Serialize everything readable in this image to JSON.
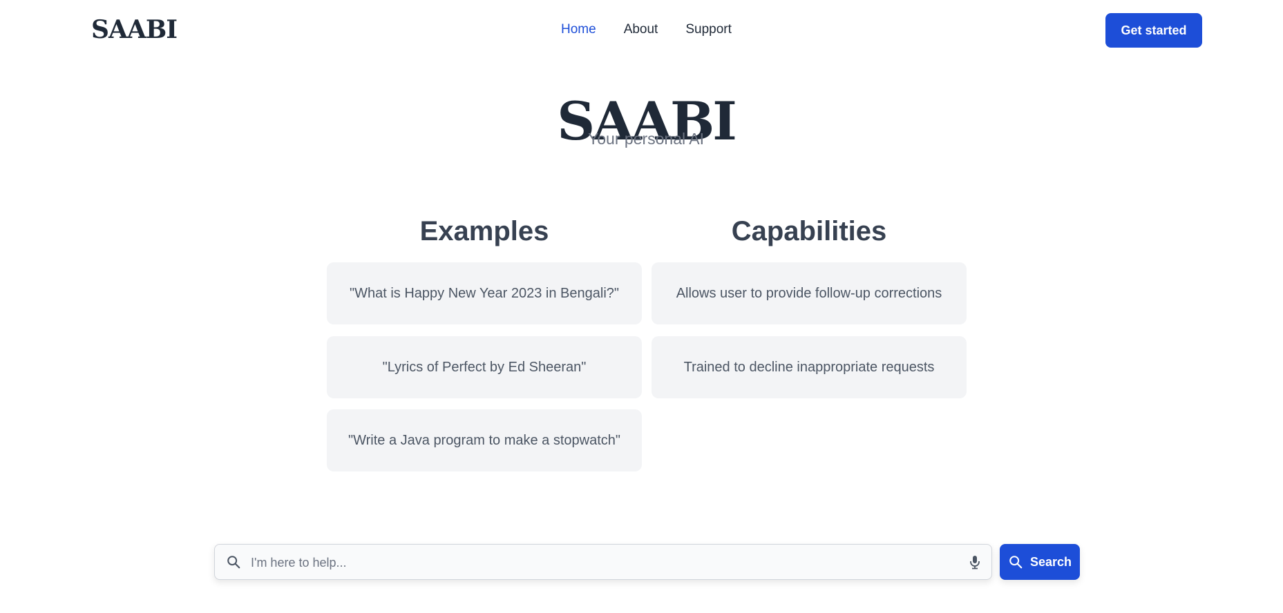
{
  "header": {
    "logo": "SAABI",
    "nav": [
      {
        "label": "Home",
        "active": true
      },
      {
        "label": "About",
        "active": false
      },
      {
        "label": "Support",
        "active": false
      }
    ],
    "cta_label": "Get started"
  },
  "hero": {
    "title": "SAABI",
    "subtitle": "Your personal AI"
  },
  "examples": {
    "title": "Examples",
    "items": [
      "\"What is Happy New Year 2023 in Bengali?\"",
      "\"Lyrics of Perfect by Ed Sheeran\"",
      "\"Write a Java program to make a stopwatch\""
    ]
  },
  "capabilities": {
    "title": "Capabilities",
    "items": [
      "Allows user to provide follow-up corrections",
      "Trained to decline inappropriate requests"
    ]
  },
  "search": {
    "placeholder": "I'm here to help...",
    "value": "",
    "button_label": "Search",
    "icons": [
      "search-icon",
      "microphone-icon"
    ]
  },
  "colors": {
    "accent": "#1d4ed8",
    "card_bg": "#f3f4f6",
    "text_dark": "#1f2937",
    "text_muted": "#6b7280"
  }
}
